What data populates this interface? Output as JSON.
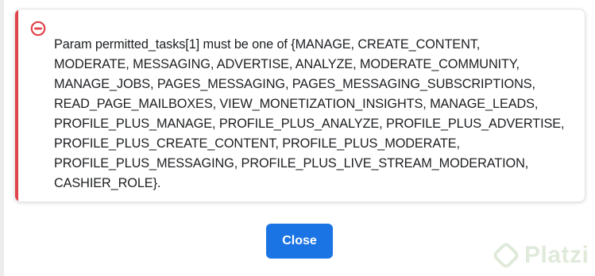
{
  "dialog": {
    "message": "Param permitted_tasks[1] must be one of {MANAGE, CREATE_CONTENT,\nMODERATE, MESSAGING, ADVERTISE, ANALYZE, MODERATE_COMMUNITY,\nMANAGE_JOBS, PAGES_MESSAGING, PAGES_MESSAGING_SUBSCRIPTIONS,\nREAD_PAGE_MAILBOXES, VIEW_MONETIZATION_INSIGHTS, MANAGE_LEADS,\nPROFILE_PLUS_MANAGE, PROFILE_PLUS_ANALYZE, PROFILE_PLUS_ADVERTISE,\nPROFILE_PLUS_CREATE_CONTENT, PROFILE_PLUS_MODERATE,\nPROFILE_PLUS_MESSAGING, PROFILE_PLUS_LIVE_STREAM_MODERATION,\nCASHIER_ROLE}.",
    "icon": "error-minus-circle-icon",
    "close_label": "Close"
  },
  "watermark": {
    "text": "Platzi",
    "icon": "platzi-logo-icon"
  },
  "colors": {
    "error_accent": "#e0444b",
    "primary_button": "#1b74e4",
    "text": "#1c1e21"
  }
}
